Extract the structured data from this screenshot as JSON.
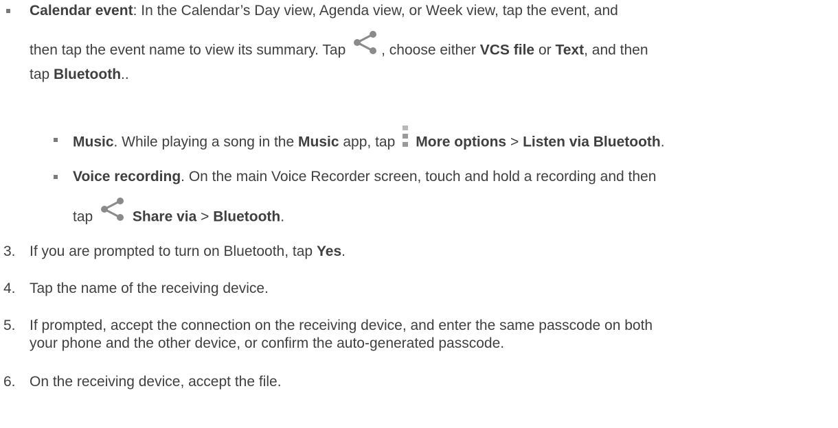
{
  "calendar": {
    "title": "Calendar event",
    "text1": ": In the Calendar’s Day view, Agenda view, or Week view, tap the event, and",
    "text2": "then tap the event name to view its summary. Tap",
    "text3": ", choose either",
    "vcs": "VCS file",
    "or": "or",
    "text_opt": "Text",
    "and_then": ", and then",
    "tap": "tap",
    "bluetooth": "Bluetooth",
    "end": ".."
  },
  "music": {
    "title": "Music",
    "text1": ". While playing a song in the",
    "app_name": "Music",
    "text2": "app, tap",
    "more_options": "More options",
    "sep": ">",
    "listen": "Listen via Bluetooth",
    "end": "."
  },
  "voice": {
    "title": "Voice recording",
    "text1": ". On the main Voice Recorder screen, touch and hold a recording and then",
    "tap": "tap",
    "share_via": "Share via",
    "sep": ">",
    "bluetooth": "Bluetooth",
    "end": "."
  },
  "steps": [
    {
      "num": "3.",
      "text": "If you are prompted to turn on Bluetooth, tap ",
      "bold": "Yes",
      "end": "."
    },
    {
      "num": "4.",
      "text": "Tap the name of the receiving device."
    },
    {
      "num": "5.",
      "line1": "If prompted, accept the connection on the receiving device, and enter the same passcode on both",
      "line2": "your phone and the other device, or confirm the auto-generated passcode."
    },
    {
      "num": "6.",
      "text": "On the receiving device, accept the file."
    }
  ],
  "icons": {
    "share": "share-icon",
    "more": "more-options-icon"
  },
  "colors": {
    "text": "#3f3f3f",
    "icon": "#8a8a8a"
  }
}
